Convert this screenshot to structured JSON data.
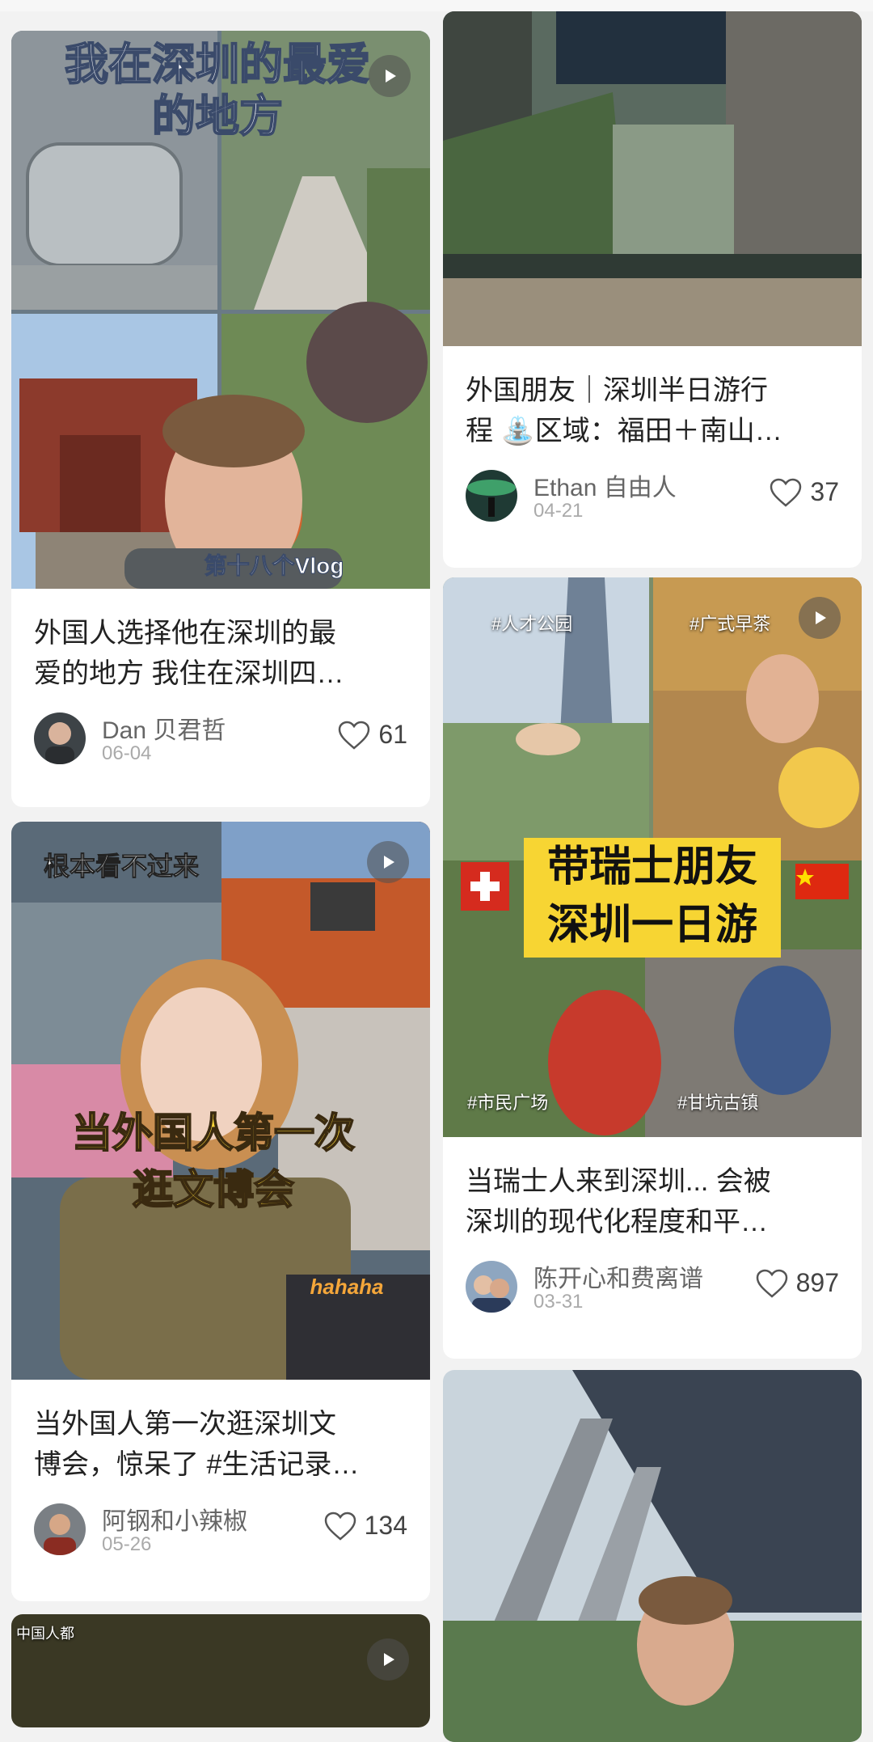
{
  "cards": [
    {
      "title": "外国人选择他在深圳的最\n爱的地方 我住在深圳四…",
      "author": "Dan 贝君哲",
      "date": "06-04",
      "likes": "61",
      "overlay_title": "我在深圳的最爱\n的地方",
      "overlay_vlog": "第十八个Vlog"
    },
    {
      "title": "当外国人第一次逛深圳文\n博会，惊呆了 #生活记录…",
      "author": "阿钢和小辣椒",
      "date": "05-26",
      "likes": "134",
      "overlay_top": "根本看不过来",
      "overlay_main": "当外国人第一次\n逛文博会",
      "overlay_watermark": "hahaha"
    },
    {
      "overlay_label": "中国人都"
    },
    {
      "title": "外国朋友｜深圳半日游行\n程 ⛲区域：福田＋南山…",
      "author": "Ethan 自由人",
      "date": "04-21",
      "likes": "37"
    },
    {
      "title": "当瑞士人来到深圳... 会被\n深圳的现代化程度和平…",
      "author": "陈开心和费离谱",
      "date": "03-31",
      "likes": "897",
      "overlay_banner": "带瑞士朋友\n深圳一日游",
      "tags": [
        "#人才公园",
        "#广式早茶",
        "#市民广场",
        "#甘坑古镇"
      ]
    },
    {}
  ],
  "colors": {
    "background": "#f2f2f2",
    "card": "#ffffff",
    "banner": "#f7d533",
    "heart": "#444444"
  },
  "icons": [
    "play-icon",
    "heart-icon",
    "flag-ch-icon",
    "flag-cn-icon"
  ]
}
